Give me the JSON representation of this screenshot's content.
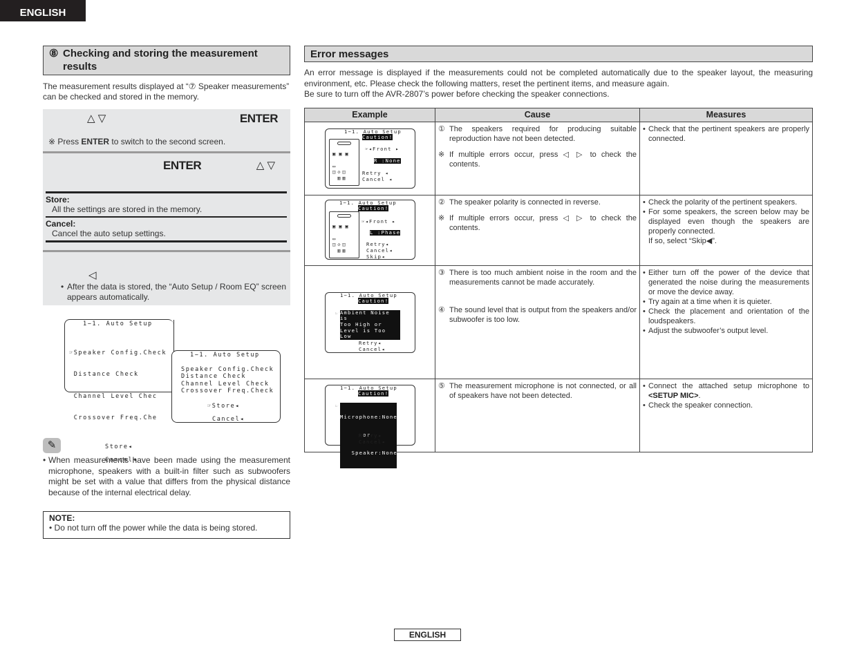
{
  "lang_tab": "ENGLISH",
  "footer": "ENGLISH",
  "left": {
    "section_number": "⑧",
    "section_title_line1": "Checking and storing the measurement",
    "section_title_line2": "results",
    "lead": "The measurement results displayed at “⑦ Speaker measurements” can be checked and stored in the memory.",
    "step1": {
      "arrows": "△ ▽",
      "enter": "ENTER",
      "note_mark": "※",
      "note_pre": " Press ",
      "note_bold": "ENTER",
      "note_post": " to switch to the second screen."
    },
    "step2": {
      "enter": "ENTER",
      "arrows": "△ ▽",
      "options": [
        {
          "title": "Store:",
          "desc": "All the settings are stored in the memory."
        },
        {
          "title": "Cancel:",
          "desc": "Cancel the auto setup settings."
        }
      ]
    },
    "step3": {
      "arrow": "◁",
      "bullet": "•",
      "text": "After the data is stored, the “Auto Setup / Room EQ” screen appears automatically."
    },
    "screen1": {
      "title": "1−1. Auto Setup",
      "lines": [
        "☞Speaker Config.Check",
        " Distance Check",
        " Channel Level Chec",
        " Crossover Freq.Che"
      ],
      "store": "Store◂",
      "cancel": "Cancel◂"
    },
    "screen2": {
      "title": "1−1. Auto Setup",
      "lines": [
        "Speaker Config.Check",
        "Distance Check",
        "Channel Level Check",
        "Crossover Freq.Check"
      ],
      "store": "☞Store◂",
      "cancel": "Cancel◂"
    },
    "hint_icon": "pencil-icon",
    "hint": "When measurements have been made using the measurement microphone, speakers with a built-in filter such as subwoofers might be set with a value that differs from the physical distance because of the internal electrical delay.",
    "note_title": "NOTE:",
    "note_text": "Do not turn off the power while the data is being stored."
  },
  "right": {
    "section_title": "Error messages",
    "intro": [
      "An error message is displayed if the measurements could not be completed automatically due to the speaker layout, the measuring environment, etc. Please check the following matters, reset the pertinent items, and measure again.",
      "Be sure to turn off the AVR-2807’s power before checking the speaker connections."
    ],
    "table": {
      "headers": [
        "Example",
        "Cause",
        "Measures"
      ],
      "rows": [
        {
          "screen": {
            "title": "1−1. Auto Setup",
            "caution": "Caution!",
            "sel": "☞◂Front ▸",
            "status": " R :None ",
            "actions": [
              "Retry ◂",
              "Cancel ◂"
            ]
          },
          "causes": [
            {
              "mark": "①",
              "text": "The speakers required for producing suitable reproduction have not been detected."
            },
            {
              "mark": "※",
              "text": "If multiple errors occur, press ◁ ▷ to check the contents."
            }
          ],
          "measures": [
            "Check that the pertinent speakers are properly connected."
          ]
        },
        {
          "screen": {
            "title": "1−1. Auto Setup",
            "caution": "Caution!",
            "sel": "☞◂Front ▸",
            "status": " L :Phase",
            "actions": [
              "Retry◂",
              "Cancel◂",
              "Skip◂"
            ]
          },
          "causes": [
            {
              "mark": "②",
              "text": "The speaker polarity is connected in reverse."
            },
            {
              "mark": "※",
              "text": "If multiple errors occur, press ◁ ▷ to check the contents."
            }
          ],
          "measures": [
            "Check the polarity of the pertinent speakers.",
            "For some speakers, the screen below may be displayed even though the speakers are properly connected.\nIf so, select “Skip◀”."
          ]
        },
        {
          "screen": {
            "title": "1−1. Auto Setup",
            "caution": "Caution!",
            "msg": [
              "Ambient Noise is",
              "Too High or",
              "Level is Too Low"
            ],
            "actions": [
              "Retry◂",
              "Cancel◂"
            ]
          },
          "causes": [
            {
              "mark": "③",
              "text": "There is too much ambient noise in the room and the measurements cannot be made accurately."
            },
            {
              "mark": "④",
              "text": "The sound level that is output from the speakers and/or subwoofer is too low."
            }
          ],
          "measures": [
            "Either turn off the power of the device that generated the noise during the measurements or move the device away.",
            "Try again at a time when it is quieter.",
            "Check the placement and orientation of the loudspeakers.",
            "Adjust the subwoofer’s output level."
          ]
        },
        {
          "screen": {
            "title": "1−1. Auto Setup",
            "caution": "Caution!",
            "msg": [
              "Microphone:None",
              "      or",
              "   Speaker:None"
            ],
            "actions": [
              "Retry◂",
              "Cancel◂"
            ]
          },
          "causes": [
            {
              "mark": "⑤",
              "text": "The measurement microphone is not connected, or all of speakers have not been detected."
            }
          ],
          "measures_rich": {
            "pre": "Connect the attached setup microphone to ",
            "bold": "<SETUP MIC>",
            "post": "."
          },
          "measures": [
            "Check the speaker connection."
          ]
        }
      ]
    }
  }
}
